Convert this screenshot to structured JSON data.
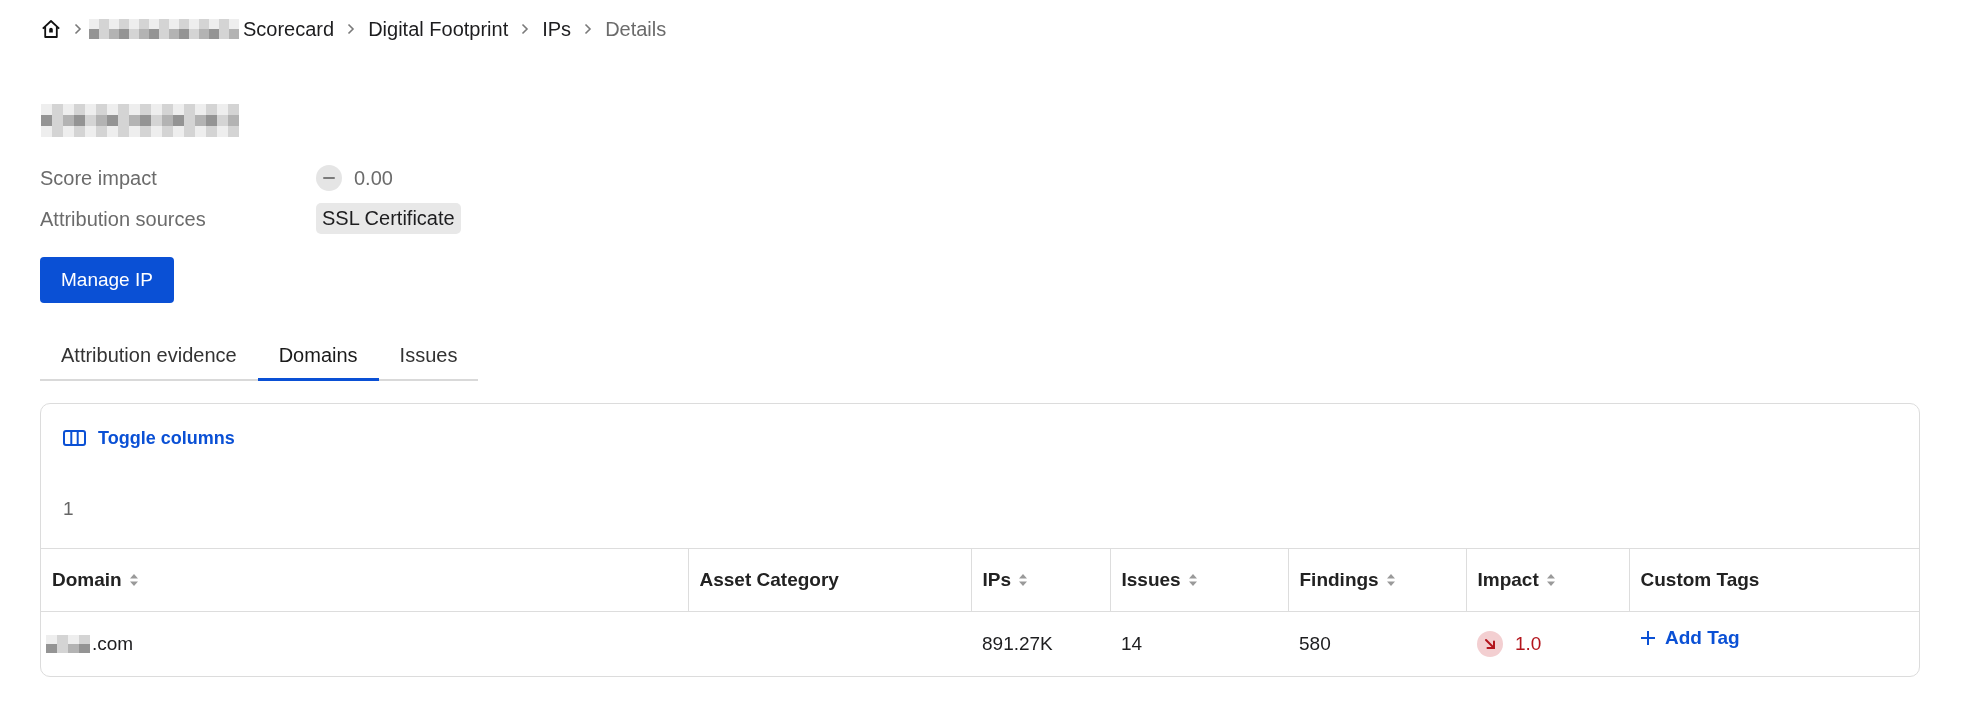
{
  "breadcrumb": {
    "items": [
      {
        "label": "Scorecard",
        "redacted_prefix": true,
        "current": false
      },
      {
        "label": "Digital Footprint",
        "redacted_prefix": false,
        "current": false
      },
      {
        "label": "IPs",
        "redacted_prefix": false,
        "current": false
      },
      {
        "label": "Details",
        "redacted_prefix": false,
        "current": true
      }
    ]
  },
  "title": {
    "redacted": true
  },
  "details": [
    {
      "kind": "score",
      "label": "Score impact",
      "value": "0.00",
      "negative": false
    },
    {
      "kind": "tags",
      "label": "Attribution sources",
      "tags": [
        "SSL Certificate"
      ]
    }
  ],
  "primary_button": {
    "label": "Manage IP"
  },
  "tabs": [
    {
      "label": "Attribution evidence",
      "selected": false
    },
    {
      "label": "Domains",
      "selected": true
    },
    {
      "label": "Issues",
      "selected": false
    }
  ],
  "table": {
    "toolbar_button": {
      "label": "Toggle columns"
    },
    "count": "1",
    "columns": [
      {
        "label": "Domain",
        "sortable": true
      },
      {
        "label": "Asset Category",
        "sortable": false
      },
      {
        "label": "IPs",
        "sortable": true
      },
      {
        "label": "Issues",
        "sortable": true
      },
      {
        "label": "Findings",
        "sortable": true
      },
      {
        "label": "Impact",
        "sortable": true
      },
      {
        "label": "Custom Tags",
        "sortable": false
      }
    ],
    "rows": [
      {
        "cells": [
          {
            "kind": "domain",
            "text": ".com",
            "redacted_prefix": true
          },
          {
            "kind": "empty"
          },
          {
            "kind": "text",
            "text": "891.27K"
          },
          {
            "kind": "text",
            "text": "14"
          },
          {
            "kind": "text",
            "text": "580"
          },
          {
            "kind": "impact",
            "text": "1.0",
            "negative": true
          },
          {
            "kind": "add_tag",
            "text": "Add Tag"
          }
        ]
      }
    ]
  }
}
